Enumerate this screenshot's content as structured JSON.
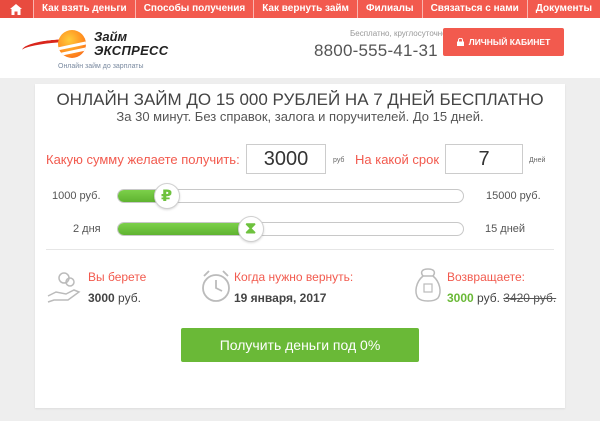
{
  "nav": {
    "items": [
      "Как взять деньги",
      "Способы получения",
      "Как вернуть займ",
      "Филиалы",
      "Связаться с нами",
      "Документы"
    ]
  },
  "header": {
    "logo_line1": "Займ",
    "logo_line2": "ЭКСПРЕСС",
    "logo_tagline": "Онлайн займ до зарплаты",
    "phone_note": "Бесплатно, круглосуточно",
    "phone": "8800-555-41-31",
    "cabinet_label": "ЛИЧНЫЙ КАБИНЕТ"
  },
  "calc": {
    "title": "ОНЛАЙН ЗАЙМ ДО 15 000 РУБЛЕЙ НА 7 ДНЕЙ БЕСПЛАТНО",
    "subtitle": "За 30 минут. Без справок, залога и поручителей. До 15 дней.",
    "amount_label": "Какую сумму желаете получить:",
    "amount_value": "3000",
    "amount_unit": "руб",
    "term_label": "На какой срок",
    "term_value": "7",
    "term_unit": "Дней",
    "amount_slider": {
      "min_label": "1000 руб.",
      "max_label": "15000 руб.",
      "handle_symbol": "₽",
      "fraction": 0.143
    },
    "term_slider": {
      "min_label": "2 дня",
      "max_label": "15 дней",
      "handle_symbol": "⧗",
      "fraction": 0.385
    }
  },
  "summary": {
    "take_label": "Вы берете",
    "take_value": "3000",
    "take_unit": "руб.",
    "return_date_label": "Когда нужно вернуть:",
    "return_date_value": "19 января, 2017",
    "repay_label": "Возвращаете:",
    "repay_value": "3000",
    "repay_unit": "руб.",
    "repay_old": "3420 руб."
  },
  "cta_label": "Получить деньги под 0%",
  "colors": {
    "accent_red": "#f25a4e",
    "accent_green": "#6ab937"
  }
}
